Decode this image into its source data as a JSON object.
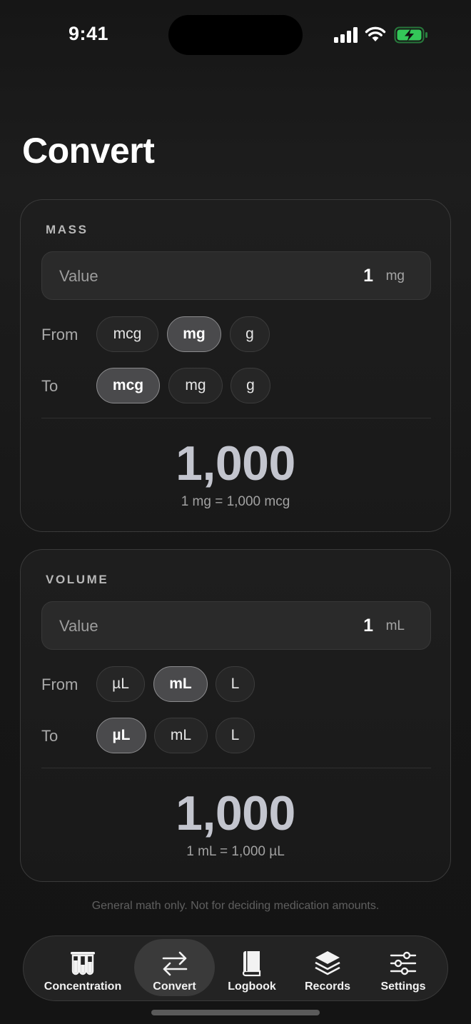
{
  "status": {
    "time": "9:41"
  },
  "title": "Convert",
  "mass": {
    "label": "MASS",
    "value_label": "Value",
    "value": "1",
    "value_unit": "mg",
    "from_label": "From",
    "to_label": "To",
    "units": [
      "mcg",
      "mg",
      "g"
    ],
    "from_selected": "mg",
    "to_selected": "mcg",
    "result": "1,000",
    "equation": "1 mg = 1,000 mcg"
  },
  "volume": {
    "label": "VOLUME",
    "value_label": "Value",
    "value": "1",
    "value_unit": "mL",
    "from_label": "From",
    "to_label": "To",
    "units": [
      "µL",
      "mL",
      "L"
    ],
    "from_selected": "mL",
    "to_selected": "µL",
    "result": "1,000",
    "equation": "1 mL = 1,000 µL"
  },
  "disclaimer": "General math only. Not for deciding medication amounts.",
  "tabs": [
    {
      "label": "Concentration",
      "icon": "test-tubes-icon"
    },
    {
      "label": "Convert",
      "icon": "arrows-swap-icon",
      "active": true
    },
    {
      "label": "Logbook",
      "icon": "book-icon"
    },
    {
      "label": "Records",
      "icon": "layers-icon"
    },
    {
      "label": "Settings",
      "icon": "sliders-icon"
    }
  ],
  "colors": {
    "battery": "#34c759",
    "selected_pill": "#4a4a4c",
    "result": "#c3c5ce"
  }
}
